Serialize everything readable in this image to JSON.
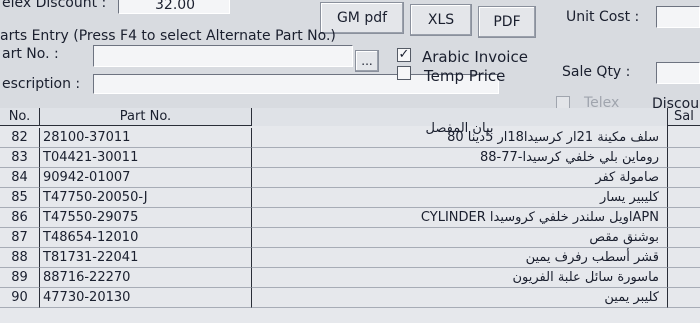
{
  "header": {
    "discount_label": "elex Discount :",
    "discount_value": "32.00",
    "parts_entry_hint": "arts Entry (Press F4 to select Alternate Part No.)",
    "part_no_label": "art No. :",
    "description_label": "escription :",
    "lookup_button": "...",
    "unit_cost_label": "Unit Cost :",
    "sale_qty_label": "Sale Qty :",
    "discount_trunc_label": "Discou"
  },
  "buttons": {
    "gm_pdf": "GM pdf",
    "xls": "XLS",
    "pdf": "PDF"
  },
  "options": {
    "arabic_invoice_label": "Arabic Invoice",
    "arabic_invoice_checked": true,
    "temp_price_label": "Temp Price",
    "temp_price_checked": false,
    "telex_label": "Telex",
    "telex_checked": false
  },
  "table": {
    "columns": [
      "No.",
      "Part No.",
      "بيان المفصل",
      "Sal"
    ],
    "rows": [
      {
        "no": "82",
        "part": "28100-37011",
        "desc": "سلف مكينة 21ار كرسيدا18ار 5دينا 80"
      },
      {
        "no": "83",
        "part": "T04421-30011",
        "desc": "روماين بلي خلفي كرسيدا-77-88"
      },
      {
        "no": "84",
        "part": "90942-01007",
        "desc": "صامولة كفر"
      },
      {
        "no": "85",
        "part": "T47750-20050-J",
        "desc": "كليبير يسار"
      },
      {
        "no": "86",
        "part": "T47550-29075",
        "desc": "APNاويل سلندر خلفي كروسيدا CYLINDER"
      },
      {
        "no": "87",
        "part": "T48654-12010",
        "desc": "بوشنق مقص"
      },
      {
        "no": "88",
        "part": "T81731-22041",
        "desc": "قشر أسطب رفرف يمين"
      },
      {
        "no": "89",
        "part": "88716-22270",
        "desc": "ماسورة سائل علبة الفريون"
      },
      {
        "no": "90",
        "part": "47730-20130",
        "desc": "كليبر يمين"
      }
    ]
  }
}
